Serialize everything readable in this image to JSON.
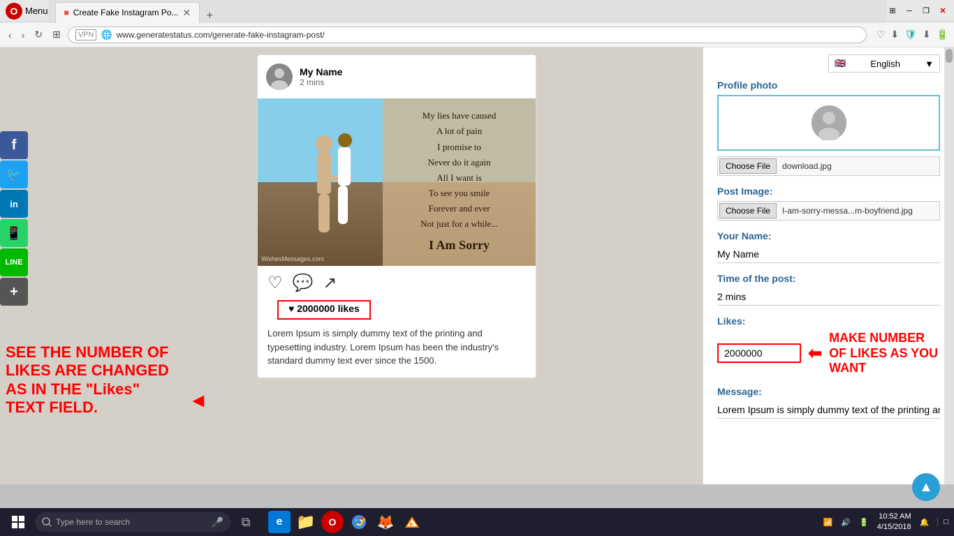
{
  "browser": {
    "title_bar": {
      "menu_label": "Menu",
      "tab_label": "Create Fake Instagram Po...",
      "close_btn": "✕",
      "minimize_btn": "─",
      "maximize_btn": "❐",
      "stack_icon": "⊞"
    },
    "address_bar": {
      "url": "www.generatestatus.com/generate-fake-instagram-post/",
      "new_tab_btn": "+",
      "vpn_label": "VPN"
    }
  },
  "social_buttons": [
    {
      "name": "facebook",
      "label": "f",
      "color": "#3b5998"
    },
    {
      "name": "twitter",
      "label": "🐦",
      "color": "#1da1f2"
    },
    {
      "name": "linkedin",
      "label": "in",
      "color": "#0077b5"
    },
    {
      "name": "whatsapp",
      "label": "📱",
      "color": "#25d366"
    },
    {
      "name": "line",
      "label": "LINE",
      "color": "#00b900"
    },
    {
      "name": "add",
      "label": "+",
      "color": "#555"
    }
  ],
  "annotation": {
    "text": "SEE THE NUMBER OF LIKES ARE CHANGED AS IN THE \"Likes\" TEXT FIELD.",
    "arrow_char": "◄"
  },
  "instagram_post": {
    "username": "My Name",
    "time": "2 mins",
    "post_lines": [
      "My lies have caused",
      "A lot of pain",
      "I promise to",
      "Never do it again",
      "All I want is",
      "To see you smile",
      "Forever and ever",
      "Not just for a while...",
      "I Am Sorry"
    ],
    "watermark": "WishesMessages.com",
    "likes_count": "2000000 likes",
    "likes_heart": "♥",
    "caption": "Lorem Ipsum is simply dummy text of the printing and typesetting industry. Lorem Ipsum has been the industry's standard dummy text ever since the 1500.",
    "action_heart": "♡",
    "action_comment": "💬",
    "action_share": "↗"
  },
  "right_panel": {
    "language": {
      "flag": "🇬🇧",
      "label": "English",
      "dropdown_arrow": "▼"
    },
    "profile_photo": {
      "section_label": "Profile photo",
      "choose_file_btn": "Choose File",
      "file_name": "download.jpg"
    },
    "post_image": {
      "section_label": "Post Image:",
      "choose_file_btn": "Choose File",
      "file_name": "I-am-sorry-messa...m-boyfriend.jpg"
    },
    "your_name": {
      "section_label": "Your Name:",
      "value": "My Name"
    },
    "time_of_post": {
      "section_label": "Time of the post:",
      "value": "2 mins"
    },
    "likes": {
      "section_label": "Likes:",
      "value": "2000000"
    },
    "make_likes_annotation": "MAKE NUMBER OF LIKES AS YOU WANT",
    "message": {
      "section_label": "Message:",
      "value": "Lorem Ipsum is simply dummy text of the printing and..."
    }
  },
  "taskbar": {
    "start_tooltip": "Start",
    "search_placeholder": "Type here to search",
    "mic_icon": "🎤",
    "task_view_icon": "⧉",
    "apps": [
      {
        "name": "edge",
        "color": "#0078d7",
        "icon": "e"
      },
      {
        "name": "file-explorer",
        "color": "#ffb900",
        "icon": "📁"
      },
      {
        "name": "opera-gx",
        "color": "#ff0000",
        "icon": "O"
      },
      {
        "name": "chrome",
        "color": "#4285f4",
        "icon": "●"
      },
      {
        "name": "firefox",
        "color": "#ff6611",
        "icon": "🦊"
      },
      {
        "name": "vlc",
        "color": "#ff8800",
        "icon": "▶"
      }
    ],
    "system_icons": {
      "network": "📶",
      "volume": "🔊",
      "battery": "🔋",
      "notifications": "🔔",
      "show_desktop": "□"
    },
    "time": "10:52 AM",
    "date": "4/15/2018"
  }
}
